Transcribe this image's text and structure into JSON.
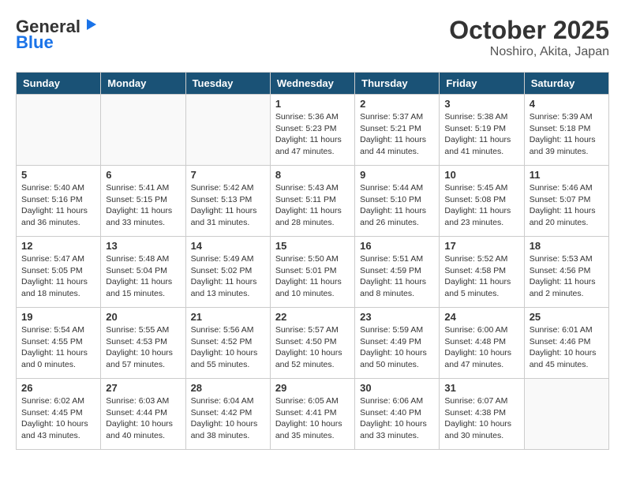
{
  "header": {
    "logo_line1": "General",
    "logo_line2": "Blue",
    "title": "October 2025",
    "subtitle": "Noshiro, Akita, Japan"
  },
  "weekdays": [
    "Sunday",
    "Monday",
    "Tuesday",
    "Wednesday",
    "Thursday",
    "Friday",
    "Saturday"
  ],
  "weeks": [
    [
      {
        "num": "",
        "info": ""
      },
      {
        "num": "",
        "info": ""
      },
      {
        "num": "",
        "info": ""
      },
      {
        "num": "1",
        "info": "Sunrise: 5:36 AM\nSunset: 5:23 PM\nDaylight: 11 hours and 47 minutes."
      },
      {
        "num": "2",
        "info": "Sunrise: 5:37 AM\nSunset: 5:21 PM\nDaylight: 11 hours and 44 minutes."
      },
      {
        "num": "3",
        "info": "Sunrise: 5:38 AM\nSunset: 5:19 PM\nDaylight: 11 hours and 41 minutes."
      },
      {
        "num": "4",
        "info": "Sunrise: 5:39 AM\nSunset: 5:18 PM\nDaylight: 11 hours and 39 minutes."
      }
    ],
    [
      {
        "num": "5",
        "info": "Sunrise: 5:40 AM\nSunset: 5:16 PM\nDaylight: 11 hours and 36 minutes."
      },
      {
        "num": "6",
        "info": "Sunrise: 5:41 AM\nSunset: 5:15 PM\nDaylight: 11 hours and 33 minutes."
      },
      {
        "num": "7",
        "info": "Sunrise: 5:42 AM\nSunset: 5:13 PM\nDaylight: 11 hours and 31 minutes."
      },
      {
        "num": "8",
        "info": "Sunrise: 5:43 AM\nSunset: 5:11 PM\nDaylight: 11 hours and 28 minutes."
      },
      {
        "num": "9",
        "info": "Sunrise: 5:44 AM\nSunset: 5:10 PM\nDaylight: 11 hours and 26 minutes."
      },
      {
        "num": "10",
        "info": "Sunrise: 5:45 AM\nSunset: 5:08 PM\nDaylight: 11 hours and 23 minutes."
      },
      {
        "num": "11",
        "info": "Sunrise: 5:46 AM\nSunset: 5:07 PM\nDaylight: 11 hours and 20 minutes."
      }
    ],
    [
      {
        "num": "12",
        "info": "Sunrise: 5:47 AM\nSunset: 5:05 PM\nDaylight: 11 hours and 18 minutes."
      },
      {
        "num": "13",
        "info": "Sunrise: 5:48 AM\nSunset: 5:04 PM\nDaylight: 11 hours and 15 minutes."
      },
      {
        "num": "14",
        "info": "Sunrise: 5:49 AM\nSunset: 5:02 PM\nDaylight: 11 hours and 13 minutes."
      },
      {
        "num": "15",
        "info": "Sunrise: 5:50 AM\nSunset: 5:01 PM\nDaylight: 11 hours and 10 minutes."
      },
      {
        "num": "16",
        "info": "Sunrise: 5:51 AM\nSunset: 4:59 PM\nDaylight: 11 hours and 8 minutes."
      },
      {
        "num": "17",
        "info": "Sunrise: 5:52 AM\nSunset: 4:58 PM\nDaylight: 11 hours and 5 minutes."
      },
      {
        "num": "18",
        "info": "Sunrise: 5:53 AM\nSunset: 4:56 PM\nDaylight: 11 hours and 2 minutes."
      }
    ],
    [
      {
        "num": "19",
        "info": "Sunrise: 5:54 AM\nSunset: 4:55 PM\nDaylight: 11 hours and 0 minutes."
      },
      {
        "num": "20",
        "info": "Sunrise: 5:55 AM\nSunset: 4:53 PM\nDaylight: 10 hours and 57 minutes."
      },
      {
        "num": "21",
        "info": "Sunrise: 5:56 AM\nSunset: 4:52 PM\nDaylight: 10 hours and 55 minutes."
      },
      {
        "num": "22",
        "info": "Sunrise: 5:57 AM\nSunset: 4:50 PM\nDaylight: 10 hours and 52 minutes."
      },
      {
        "num": "23",
        "info": "Sunrise: 5:59 AM\nSunset: 4:49 PM\nDaylight: 10 hours and 50 minutes."
      },
      {
        "num": "24",
        "info": "Sunrise: 6:00 AM\nSunset: 4:48 PM\nDaylight: 10 hours and 47 minutes."
      },
      {
        "num": "25",
        "info": "Sunrise: 6:01 AM\nSunset: 4:46 PM\nDaylight: 10 hours and 45 minutes."
      }
    ],
    [
      {
        "num": "26",
        "info": "Sunrise: 6:02 AM\nSunset: 4:45 PM\nDaylight: 10 hours and 43 minutes."
      },
      {
        "num": "27",
        "info": "Sunrise: 6:03 AM\nSunset: 4:44 PM\nDaylight: 10 hours and 40 minutes."
      },
      {
        "num": "28",
        "info": "Sunrise: 6:04 AM\nSunset: 4:42 PM\nDaylight: 10 hours and 38 minutes."
      },
      {
        "num": "29",
        "info": "Sunrise: 6:05 AM\nSunset: 4:41 PM\nDaylight: 10 hours and 35 minutes."
      },
      {
        "num": "30",
        "info": "Sunrise: 6:06 AM\nSunset: 4:40 PM\nDaylight: 10 hours and 33 minutes."
      },
      {
        "num": "31",
        "info": "Sunrise: 6:07 AM\nSunset: 4:38 PM\nDaylight: 10 hours and 30 minutes."
      },
      {
        "num": "",
        "info": ""
      }
    ]
  ]
}
